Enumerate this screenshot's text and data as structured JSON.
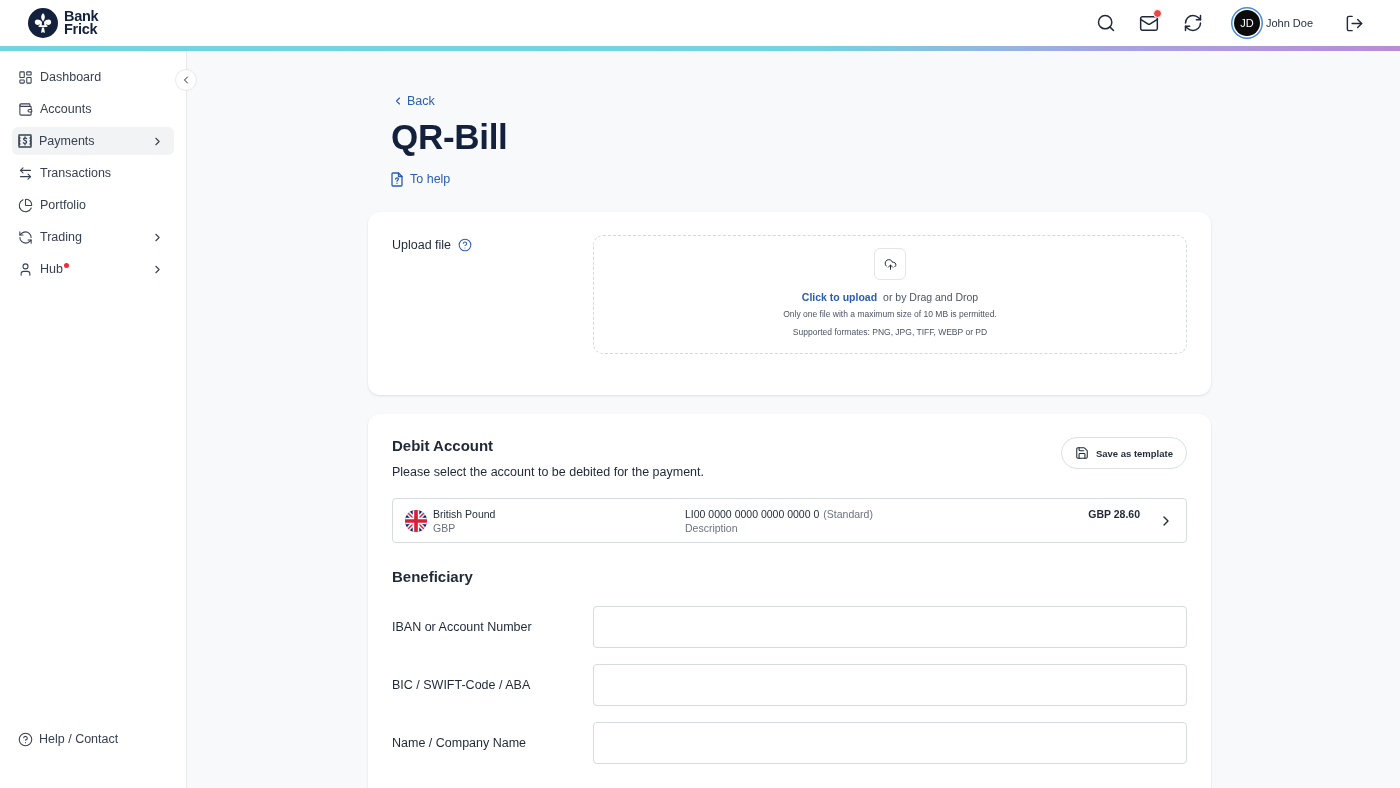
{
  "header": {
    "logo": {
      "line_1": "Bank",
      "line_2": "Frick"
    },
    "mail": {
      "unread": true
    },
    "user": {
      "initials": "JD",
      "name": "John Doe"
    }
  },
  "sidebar": {
    "items": [
      {
        "label": "Dashboard",
        "selected": false,
        "has_submenu": false,
        "alert": false
      },
      {
        "label": "Accounts",
        "selected": false,
        "has_submenu": false,
        "alert": false
      },
      {
        "label": "Payments",
        "selected": true,
        "has_submenu": true,
        "alert": false
      },
      {
        "label": "Transactions",
        "selected": false,
        "has_submenu": false,
        "alert": false
      },
      {
        "label": "Portfolio",
        "selected": false,
        "has_submenu": false,
        "alert": false
      },
      {
        "label": "Trading",
        "selected": false,
        "has_submenu": true,
        "alert": false
      },
      {
        "label": "Hub",
        "selected": false,
        "has_submenu": true,
        "alert": true
      }
    ],
    "footer_link": "Help / Contact"
  },
  "page": {
    "back_link": "Back",
    "title": "QR-Bill",
    "help_link": "To help"
  },
  "upload": {
    "label": "Upload file",
    "link": "Click to upload",
    "drop_text": "or by Drag and Drop",
    "limit_note": "Only one file with a maximum size of 10 MB is permitted.",
    "formats_note": "Supported formates: PNG, JPG, TIFF, WEBP or PD"
  },
  "debit_account": {
    "title": "Debit Account",
    "description": "Please select the account to be debited for the payment.",
    "save_button": "Save as template",
    "account": {
      "currency_name": "British Pound",
      "currency_code": "GBP",
      "iban": "LI00 0000 0000 0000 0000 0",
      "iban_note": "(Standard)",
      "description": "Description",
      "balance": "GBP 28.60"
    }
  },
  "beneficiary": {
    "title": "Beneficiary",
    "fields": [
      {
        "label": "IBAN or Account Number"
      },
      {
        "label": "BIC / SWIFT-Code / ABA"
      },
      {
        "label": "Name / Company Name"
      }
    ]
  }
}
